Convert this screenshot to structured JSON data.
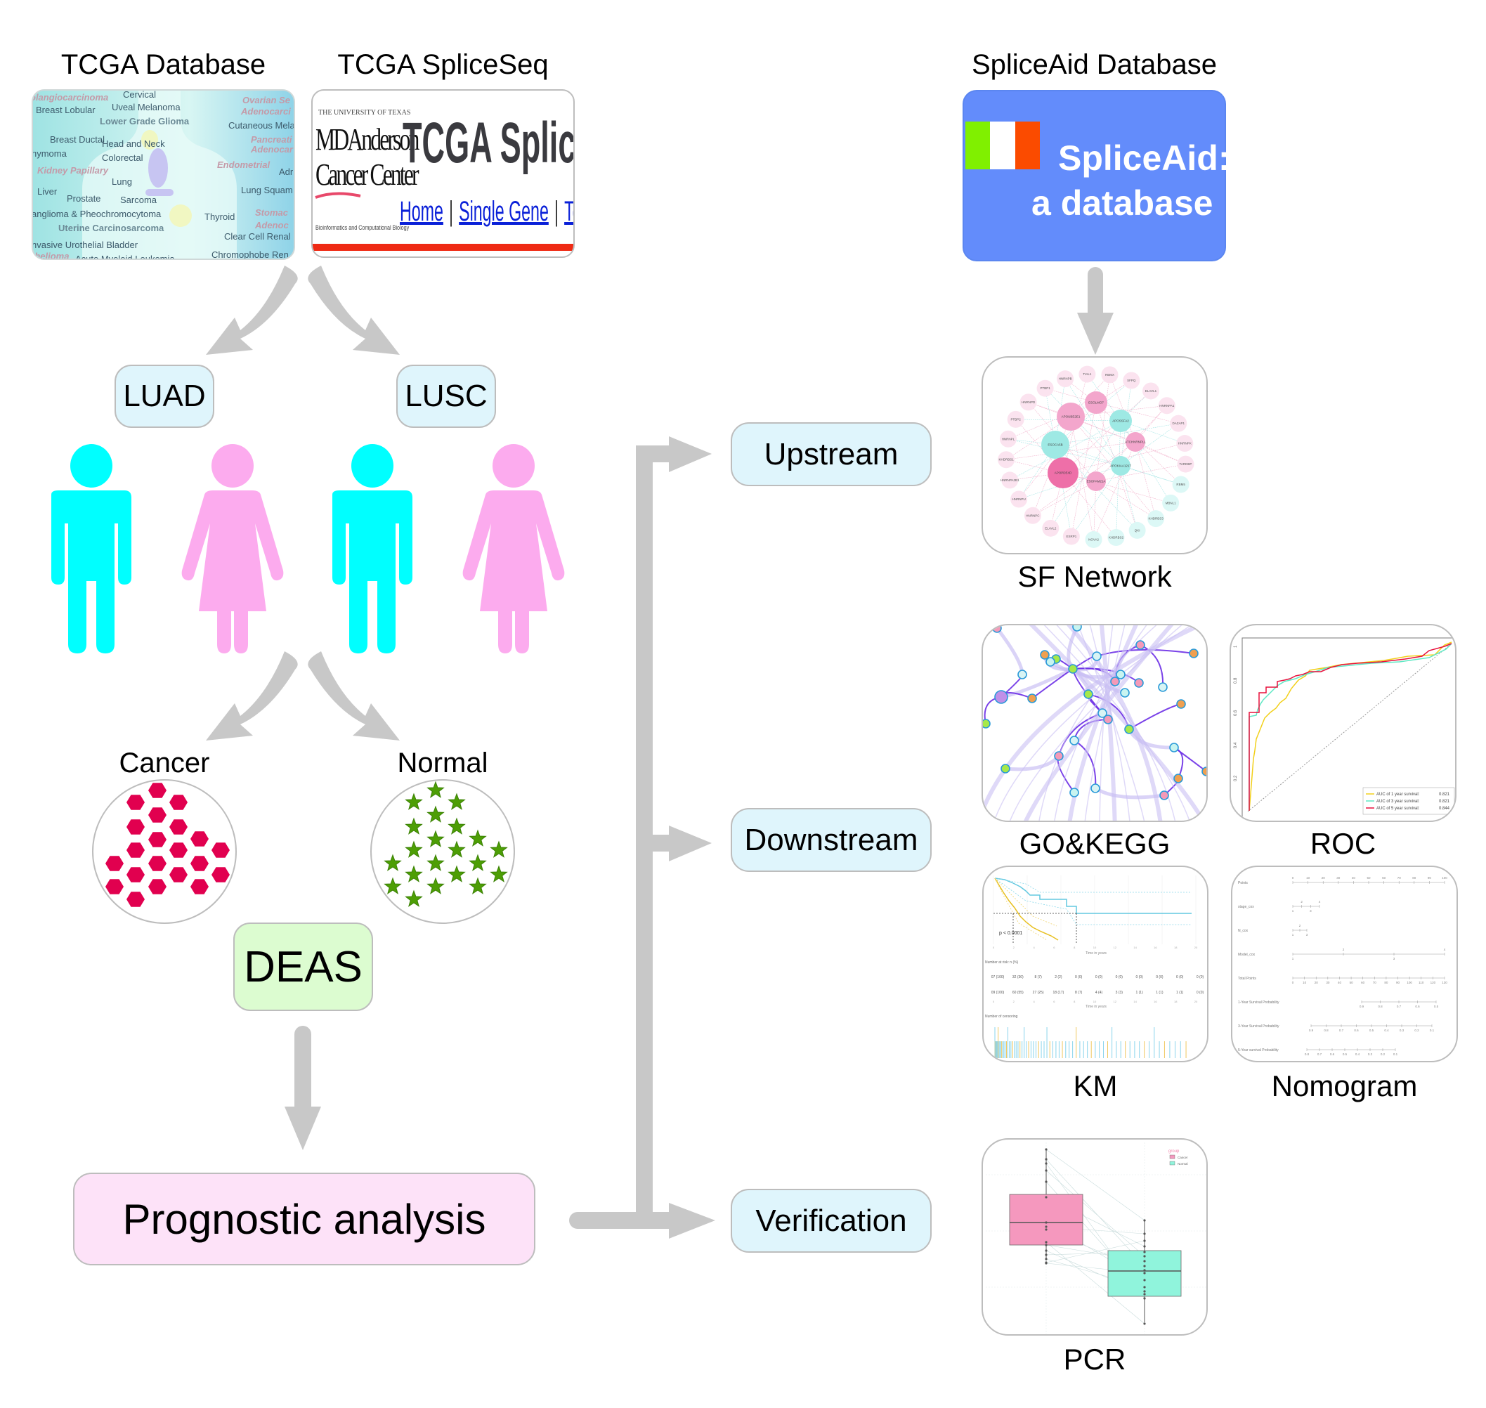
{
  "sources": {
    "tcga_database": {
      "title": "TCGA Database",
      "cancer_types": [
        "olangiocarcinoma",
        "Cervical",
        "Ovarian Se",
        "Breast Lobular",
        "Uveal Melanoma",
        "Adenocarci",
        "Lower Grade Glioma",
        "Cutaneous Mela",
        "Breast Ductal",
        "Head and Neck",
        "Pancreati",
        "hymoma",
        "Adenocar",
        "Colorectal",
        "Endometrial",
        "Kidney Papillary",
        "Adr",
        "Lung",
        "Liver",
        "Lung Squam",
        "Prostate",
        "Sarcoma",
        "anglioma & Pheochromocytoma",
        "Thyroid",
        "Stomac",
        "Uterine Carcinosarcoma",
        "Adenoc",
        "Clear Cell Renal",
        "nvasive Urothelial Bladder",
        "Chromophobe Ren",
        "thelioma",
        "Acute Myeloid Leukemia"
      ]
    },
    "tcga_spliceseq": {
      "title": "TCGA SpliceSeq",
      "university": "THE UNIVERSITY OF TEXAS",
      "md_anderson": "MDAnderson",
      "cancer_center": "Cancer Center",
      "bio_line": "Bioinformatics and Computational Biology",
      "banner": "TCGA SpliceSeq",
      "nav_links": [
        "Home",
        "Single Gene",
        "Top Ev"
      ]
    },
    "spliceaid": {
      "title": "SpliceAid Database",
      "line1": "SpliceAid:",
      "line2": "a database",
      "flag_colors": [
        "#80f000",
        "#ffffff",
        "#fb4b00"
      ]
    }
  },
  "cohorts": [
    {
      "label": "LUAD"
    },
    {
      "label": "LUSC"
    }
  ],
  "people_colors": {
    "male": "#00ffff",
    "female": "#fcabee"
  },
  "groups": {
    "cancer": {
      "label": "Cancer",
      "color": "#e1004f"
    },
    "normal": {
      "label": "Normal",
      "color": "#4d9e05"
    }
  },
  "deas": {
    "label": "DEAS"
  },
  "prognostic": {
    "label": "Prognostic analysis"
  },
  "branches": {
    "upstream": "Upstream",
    "downstream": "Downstream",
    "verification": "Verification"
  },
  "results": {
    "sf_network": {
      "caption": "SF Network",
      "nodes_pink": [
        "HNRNPB",
        "TIAL1",
        "RBMX",
        "SFPQ",
        "PTBP1",
        "ELAVL1",
        "HNRNPD",
        "HNRNPA1",
        "PTBP2",
        "DAZAP1",
        "HNRNPL",
        "HNRNPK",
        "KHDRBS1",
        "TARDBP",
        "HNRNPA2B1",
        "HNRNPU",
        "HNRNPC",
        "ELAVL2",
        "ESRP1"
      ],
      "nodes_cyan": [
        "RBM5",
        "MBNL1",
        "KHDRBS3",
        "QKI",
        "KHDRBS2",
        "NOVA2"
      ],
      "hubs": [
        {
          "name": "ESOLMO7",
          "group": "pink"
        },
        {
          "name": "APOUBE2E1",
          "group": "pink"
        },
        {
          "name": "APOSSFA2",
          "group": "cyan"
        },
        {
          "name": "ESOCA5B",
          "group": "cyan"
        },
        {
          "name": "ATCHNRNPLL",
          "group": "pink"
        },
        {
          "name": "APOPDE4D",
          "group": "pink"
        },
        {
          "name": "APOKIAA1217",
          "group": "cyan"
        },
        {
          "name": "ESOFAM21A",
          "group": "pink"
        }
      ]
    },
    "go_kegg": {
      "caption": "GO&KEGG"
    },
    "roc": {
      "caption": "ROC",
      "legend": [
        {
          "label": "AUC of 1 year survival:",
          "value": "0.821",
          "color": "#f2d01a"
        },
        {
          "label": "AUC of 3 year survival:",
          "value": "0.821",
          "color": "#5ee8c4"
        },
        {
          "label": "AUC of 5 year survival:",
          "value": "0.844",
          "color": "#e8103c"
        }
      ],
      "y_ticks": [
        "0.2",
        "0.4",
        "0.6",
        "0.8",
        "1"
      ],
      "x_ticks": [
        "0.2",
        "0.4",
        "0.6",
        "0.8"
      ]
    },
    "km": {
      "caption": "KM",
      "p_value": "p < 0.0001",
      "x_label": "Time in years",
      "x_ticks": [
        "0",
        "2",
        "4",
        "6",
        "8",
        "10",
        "12",
        "14",
        "16",
        "18",
        "20"
      ],
      "risk_title": "Number at risk: n (%)",
      "risk_rows": [
        [
          "07 (100)",
          "32 (30)",
          "8 (7)",
          "2 (2)",
          "0 (0)",
          "0 (0)",
          "0 (0)",
          "0 (0)",
          "0 (0)",
          "0 (0)",
          "0 (0)"
        ],
        [
          "09 (100)",
          "60 (55)",
          "27 (25)",
          "18 (17)",
          "8 (7)",
          "4 (4)",
          "3 (3)",
          "1 (1)",
          "1 (1)",
          "1 (1)",
          "0 (0)"
        ]
      ],
      "censoring_title": "Number of censoring"
    },
    "nomogram": {
      "caption": "Nomogram",
      "rows": [
        {
          "label": "Points",
          "ticks": [
            "0",
            "10",
            "20",
            "30",
            "40",
            "50",
            "60",
            "70",
            "80",
            "90",
            "100"
          ]
        },
        {
          "label": "stage_cox",
          "ticks": [
            "1",
            "2",
            "3",
            "4"
          ]
        },
        {
          "label": "N_cox",
          "ticks": [
            "1",
            "2",
            "3"
          ]
        },
        {
          "label": "Model_cox",
          "ticks": [
            "1",
            "2",
            "3",
            "4"
          ]
        },
        {
          "label": "Total Points",
          "ticks": [
            "0",
            "10",
            "20",
            "30",
            "40",
            "50",
            "60",
            "70",
            "80",
            "90",
            "100",
            "110",
            "120",
            "130"
          ]
        },
        {
          "label": "1-Year Survival Probability",
          "ticks": [
            "0.9",
            "0.8",
            "0.7",
            "0.6",
            "0.5"
          ]
        },
        {
          "label": "3-Year Survival Probability",
          "ticks": [
            "0.9",
            "0.8",
            "0.7",
            "0.6",
            "0.5",
            "0.4",
            "0.3",
            "0.2",
            "0.1"
          ]
        },
        {
          "label": "5-Year survival Probability",
          "ticks": [
            "0.8",
            "0.7",
            "0.6",
            "0.5",
            "0.4",
            "0.3",
            "0.2",
            "0.1"
          ]
        }
      ]
    },
    "pcr": {
      "caption": "PCR",
      "legend_title": "group",
      "legend": [
        {
          "label": "Cancer",
          "color": "#f598be"
        },
        {
          "label": "Normal",
          "color": "#90f4dc"
        }
      ]
    }
  }
}
